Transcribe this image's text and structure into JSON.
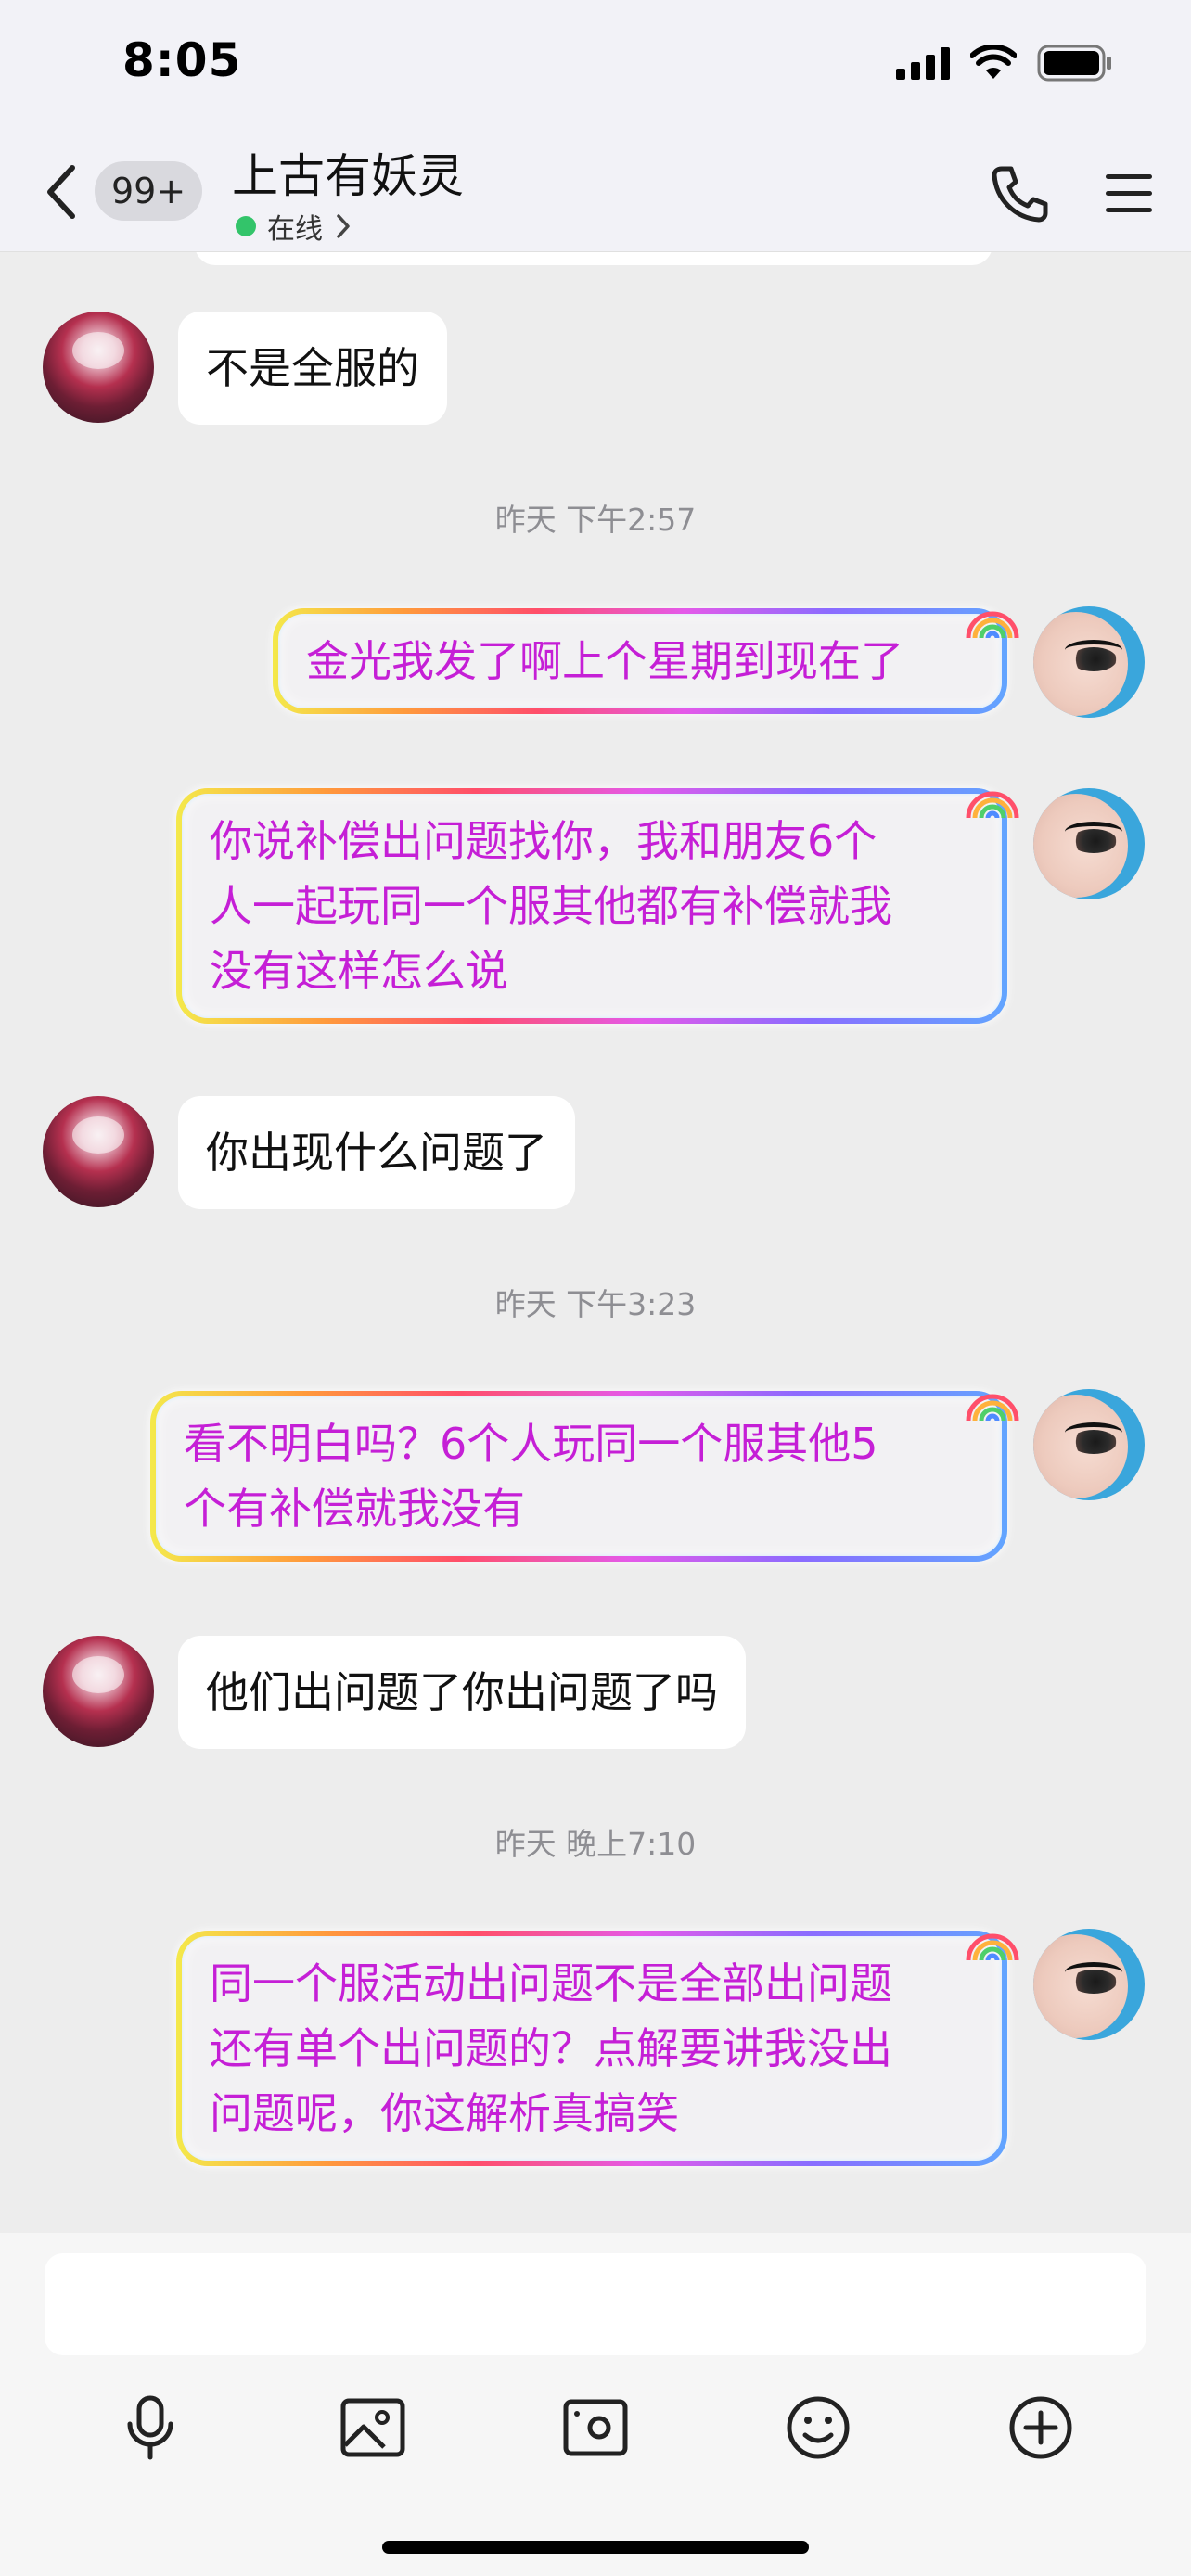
{
  "status_bar": {
    "time": "8:05"
  },
  "header": {
    "unread_count": "99+",
    "contact_name": "上古有妖灵",
    "status_text": "在线"
  },
  "messages": [
    {
      "type": "in",
      "text": "不是全服的"
    },
    {
      "type": "time",
      "text": "昨天 下午2:57"
    },
    {
      "type": "out",
      "lines": [
        "金光我发了啊上个星期到现在了"
      ]
    },
    {
      "type": "out",
      "lines": [
        "你说补偿出问题找你，我和朋友6个",
        "人一起玩同一个服其他都有补偿就我",
        "没有这样怎么说"
      ]
    },
    {
      "type": "in",
      "text": "你出现什么问题了"
    },
    {
      "type": "time",
      "text": "昨天 下午3:23"
    },
    {
      "type": "out",
      "lines": [
        "看不明白吗？6个人玩同一个服其他5",
        "个有补偿就我没有"
      ]
    },
    {
      "type": "in",
      "text": "他们出问题了你出问题了吗"
    },
    {
      "type": "time",
      "text": "昨天 晚上7:10"
    },
    {
      "type": "out",
      "lines": [
        "同一个服活动出问题不是全部出问题",
        "还有单个出问题的？点解要讲我没出",
        "问题呢，你这解析真搞笑"
      ]
    }
  ],
  "input": {
    "placeholder": ""
  },
  "toolbar": {
    "icons": [
      "microphone-icon",
      "image-icon",
      "camera-icon",
      "emoji-icon",
      "plus-icon"
    ]
  },
  "colors": {
    "outgoing_text": "#c51fd6",
    "online_dot": "#33c46a",
    "background": "#ededed"
  }
}
